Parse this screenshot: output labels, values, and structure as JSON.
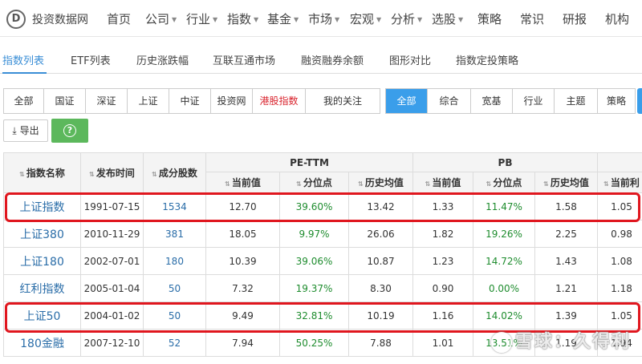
{
  "site": {
    "logo_char": "D",
    "name": "投资数据网"
  },
  "nav": [
    {
      "label": "首页",
      "dropdown": false
    },
    {
      "label": "公司",
      "dropdown": true
    },
    {
      "label": "行业",
      "dropdown": true
    },
    {
      "label": "指数",
      "dropdown": true
    },
    {
      "label": "基金",
      "dropdown": true
    },
    {
      "label": "市场",
      "dropdown": true
    },
    {
      "label": "宏观",
      "dropdown": true
    },
    {
      "label": "分析",
      "dropdown": true
    },
    {
      "label": "选股",
      "dropdown": true
    },
    {
      "label": "策略",
      "dropdown": false
    },
    {
      "label": "常识",
      "dropdown": false
    },
    {
      "label": "研报",
      "dropdown": false
    },
    {
      "label": "机构",
      "dropdown": false
    }
  ],
  "subtabs": [
    "指数列表",
    "ETF列表",
    "历史涨跌幅",
    "互联互通市场",
    "融资融券余额",
    "图形对比",
    "指数定投策略"
  ],
  "active_subtab": "指数列表",
  "filters_source": [
    {
      "label": "全部"
    },
    {
      "label": "国证"
    },
    {
      "label": "深证"
    },
    {
      "label": "上证"
    },
    {
      "label": "中证"
    },
    {
      "label": "投资网"
    },
    {
      "label": "港股指数",
      "color": "#d9232d"
    },
    {
      "label": "我的关注"
    }
  ],
  "filters_type": [
    {
      "label": "全部",
      "active": true
    },
    {
      "label": "综合"
    },
    {
      "label": "宽基"
    },
    {
      "label": "行业"
    },
    {
      "label": "主题"
    },
    {
      "label": "策略"
    }
  ],
  "toolbar": {
    "export_label": "导出",
    "export_icon": "download-icon",
    "help_icon": "question-circle-icon",
    "help_color": "#5cb85c"
  },
  "table": {
    "group_headers": {
      "pe": "PE-TTM",
      "pb": "PB"
    },
    "columns": {
      "name": "指数名称",
      "date": "发布时间",
      "count": "成分股数",
      "pe_cur": "当前值",
      "pe_pct": "分位点",
      "pe_avg": "历史均值",
      "pb_cur": "当前值",
      "pb_pct": "分位点",
      "pb_avg": "历史均值",
      "next_cur": "当前利"
    },
    "rows": [
      {
        "name": "上证指数",
        "date": "1991-07-15",
        "count": "1534",
        "pe_cur": "12.70",
        "pe_pct": "39.60%",
        "pe_avg": "13.42",
        "pb_cur": "1.33",
        "pb_pct": "11.47%",
        "pb_avg": "1.58",
        "next": "1.05",
        "highlighted": true
      },
      {
        "name": "上证380",
        "date": "2010-11-29",
        "count": "381",
        "pe_cur": "18.05",
        "pe_pct": "9.97%",
        "pe_avg": "26.06",
        "pb_cur": "1.82",
        "pb_pct": "19.26%",
        "pb_avg": "2.25",
        "next": "0.98"
      },
      {
        "name": "上证180",
        "date": "2002-07-01",
        "count": "180",
        "pe_cur": "10.39",
        "pe_pct": "39.06%",
        "pe_avg": "10.87",
        "pb_cur": "1.23",
        "pb_pct": "14.72%",
        "pb_avg": "1.43",
        "next": "1.08"
      },
      {
        "name": "红利指数",
        "date": "2005-01-04",
        "count": "50",
        "pe_cur": "7.32",
        "pe_pct": "19.37%",
        "pe_avg": "8.30",
        "pb_cur": "0.90",
        "pb_pct": "0.00%",
        "pb_avg": "1.21",
        "next": "1.18"
      },
      {
        "name": "上证50",
        "date": "2004-01-02",
        "count": "50",
        "pe_cur": "9.49",
        "pe_pct": "32.81%",
        "pe_avg": "10.19",
        "pb_cur": "1.16",
        "pb_pct": "14.02%",
        "pb_avg": "1.39",
        "next": "1.05",
        "highlighted": true
      },
      {
        "name": "180金融",
        "date": "2007-12-10",
        "count": "52",
        "pe_cur": "7.94",
        "pe_pct": "50.25%",
        "pe_avg": "7.88",
        "pb_cur": "1.01",
        "pb_pct": "13.51%",
        "pb_avg": "1.19",
        "next": "1.94"
      }
    ]
  },
  "colors": {
    "accent": "#3a9eea",
    "link": "#2a6da8",
    "percent": "#1e8c2e",
    "highlight_box": "#e0161e",
    "red_tab": "#d9232d"
  },
  "watermark": {
    "text": "雪球：久得利"
  }
}
